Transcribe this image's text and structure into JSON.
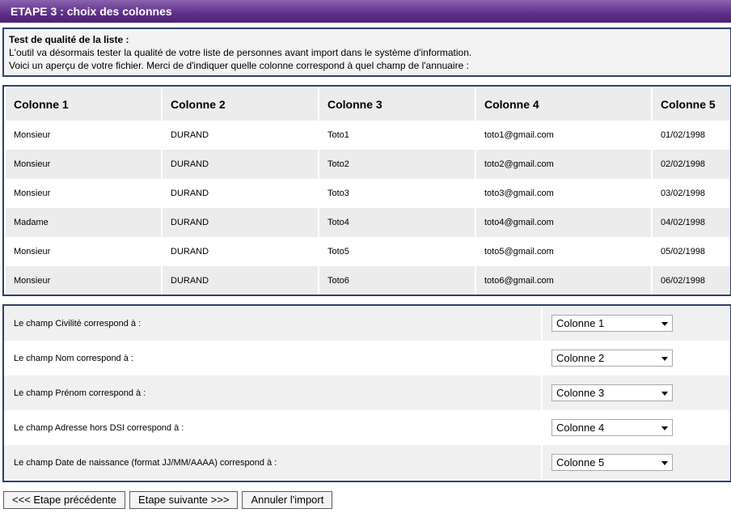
{
  "title": "ETAPE 3 : choix des colonnes",
  "info": {
    "heading": "Test de qualité de la liste :",
    "line1": "L'outil va désormais tester la qualité de votre liste de personnes avant import dans le système d'information.",
    "line2": "Voici un aperçu de votre fichier. Merci de d'indiquer quelle colonne correspond à quel champ de l'annuaire :"
  },
  "preview": {
    "headers": [
      "Colonne 1",
      "Colonne 2",
      "Colonne 3",
      "Colonne 4",
      "Colonne 5"
    ],
    "rows": [
      [
        "Monsieur",
        "DURAND",
        "Toto1",
        "toto1@gmail.com",
        "01/02/1998"
      ],
      [
        "Monsieur",
        "DURAND",
        "Toto2",
        "toto2@gmail.com",
        "02/02/1998"
      ],
      [
        "Monsieur",
        "DURAND",
        "Toto3",
        "toto3@gmail.com",
        "03/02/1998"
      ],
      [
        "Madame",
        "DURAND",
        "Toto4",
        "toto4@gmail.com",
        "04/02/1998"
      ],
      [
        "Monsieur",
        "DURAND",
        "Toto5",
        "toto5@gmail.com",
        "05/02/1998"
      ],
      [
        "Monsieur",
        "DURAND",
        "Toto6",
        "toto6@gmail.com",
        "06/02/1998"
      ]
    ]
  },
  "mapping": [
    {
      "label": "Le champ Civilité correspond à :",
      "selected": "Colonne 1"
    },
    {
      "label": "Le champ Nom correspond à :",
      "selected": "Colonne 2"
    },
    {
      "label": "Le champ Prénom correspond à :",
      "selected": "Colonne 3"
    },
    {
      "label": "Le champ Adresse hors DSI correspond à :",
      "selected": "Colonne 4"
    },
    {
      "label": "Le champ Date de naissance (format JJ/MM/AAAA) correspond à :",
      "selected": "Colonne 5"
    }
  ],
  "buttons": {
    "previous": "<<< Etape précédente",
    "next": "Etape suivante >>>",
    "cancel": "Annuler l'import"
  },
  "colors": {
    "title_bar": "#5d2f88",
    "border": "#2f3f6e",
    "row_alt": "#ececec"
  },
  "icons": {
    "select_arrow": "chevron-down-icon"
  }
}
